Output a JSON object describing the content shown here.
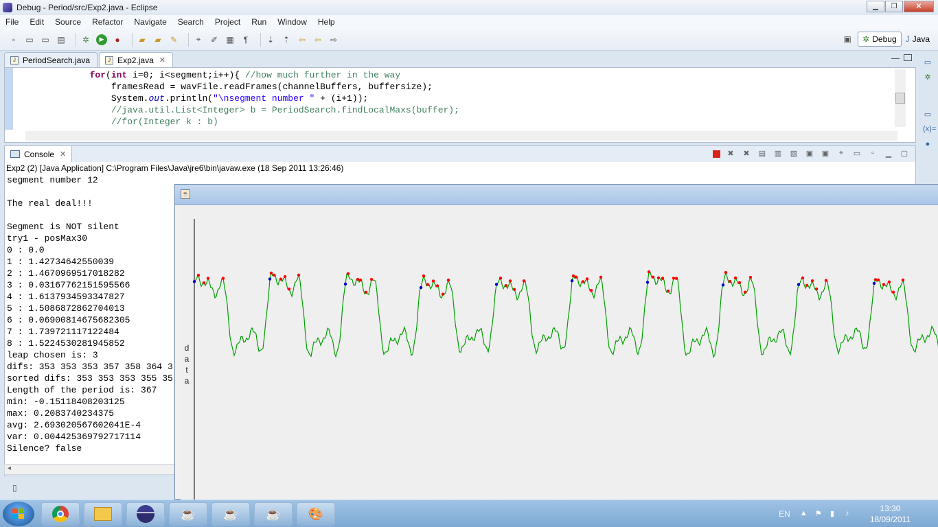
{
  "window": {
    "title": "Debug - Period/src/Exp2.java - Eclipse"
  },
  "menu": [
    "File",
    "Edit",
    "Source",
    "Refactor",
    "Navigate",
    "Search",
    "Project",
    "Run",
    "Window",
    "Help"
  ],
  "perspectives": {
    "debug": "Debug",
    "java": "Java"
  },
  "editor": {
    "tabs": [
      {
        "label": "PeriodSearch.java",
        "active": false
      },
      {
        "label": "Exp2.java",
        "active": true
      }
    ],
    "code_lines": [
      "            for(int i=0; i<segment;i++){ //how much further in the way",
      "                framesRead = wavFile.readFrames(channelBuffers, buffersize);",
      "                System.out.println(\"\\nsegment number \" + (i+1));",
      "                //java.util.List<Integer> b = PeriodSearch.findLocalMaxs(buffer);",
      "                //for(Integer k : b)"
    ]
  },
  "console": {
    "tab_label": "Console",
    "header": "Exp2 (2) [Java Application] C:\\Program Files\\Java\\jre6\\bin\\javaw.exe (18 Sep 2011 13:26:46)",
    "lines": [
      "segment number 12",
      "",
      "The real deal!!!",
      "",
      "Segment is NOT silent",
      "try1 - posMax30",
      "0 : 0.0",
      "1 : 1.42734642550039",
      "2 : 1.4670969517018282",
      "3 : 0.03167762151595566",
      "4 : 1.6137934593347827",
      "5 : 1.5086872862704013",
      "6 : 0.06900814675682305",
      "7 : 1.739721117122484",
      "8 : 1.5224530281945852",
      "leap chosen is: 3",
      "difs: 353 353 353 357 358 364 3",
      "sorted difs: 353 353 353 355 35",
      "Length of the period is: 367",
      "min: -0.15118408203125",
      "max: 0.2083740234375",
      "avg: 2.693020567602041E-4",
      "var: 0.004425369792717114",
      "Silence? false"
    ]
  },
  "plot": {
    "ylabel_letters": [
      "d",
      "a",
      "t",
      "a"
    ],
    "line_color": "#00a000",
    "max_color": "#ff0000",
    "min_color": "#0000cc"
  },
  "taskbar": {
    "language": "EN",
    "time": "13:30",
    "date": "18/09/2011"
  }
}
